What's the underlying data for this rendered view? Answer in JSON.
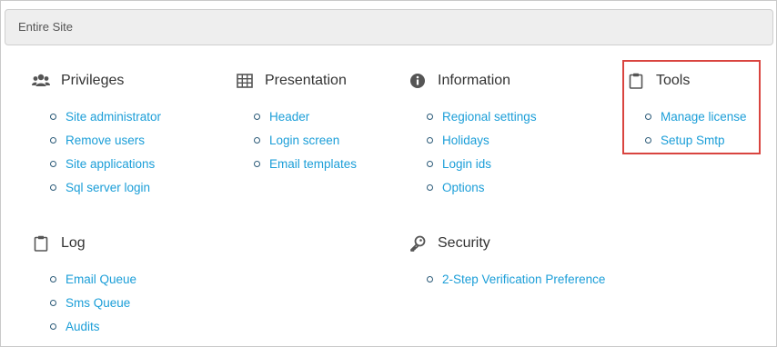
{
  "site_bar": {
    "label": "Entire Site"
  },
  "sections": {
    "privileges": {
      "title": "Privileges",
      "icon": "users-icon",
      "links": [
        "Site administrator",
        "Remove users",
        "Site applications",
        "Sql server login"
      ]
    },
    "presentation": {
      "title": "Presentation",
      "icon": "grid-icon",
      "links": [
        "Header",
        "Login screen",
        "Email templates"
      ]
    },
    "information": {
      "title": "Information",
      "icon": "info-icon",
      "links": [
        "Regional settings",
        "Holidays",
        "Login ids",
        "Options"
      ]
    },
    "tools": {
      "title": "Tools",
      "icon": "clipboard-icon",
      "links": [
        "Manage license",
        "Setup Smtp"
      ]
    },
    "log": {
      "title": "Log",
      "icon": "clipboard-icon",
      "links": [
        "Email Queue",
        "Sms Queue",
        "Audits"
      ]
    },
    "security": {
      "title": "Security",
      "icon": "key-icon",
      "links": [
        "2-Step Verification Preference"
      ]
    }
  },
  "colors": {
    "link": "#1b9ed8",
    "highlight_border": "#d9443f",
    "bar_bg": "#eeeeee"
  }
}
